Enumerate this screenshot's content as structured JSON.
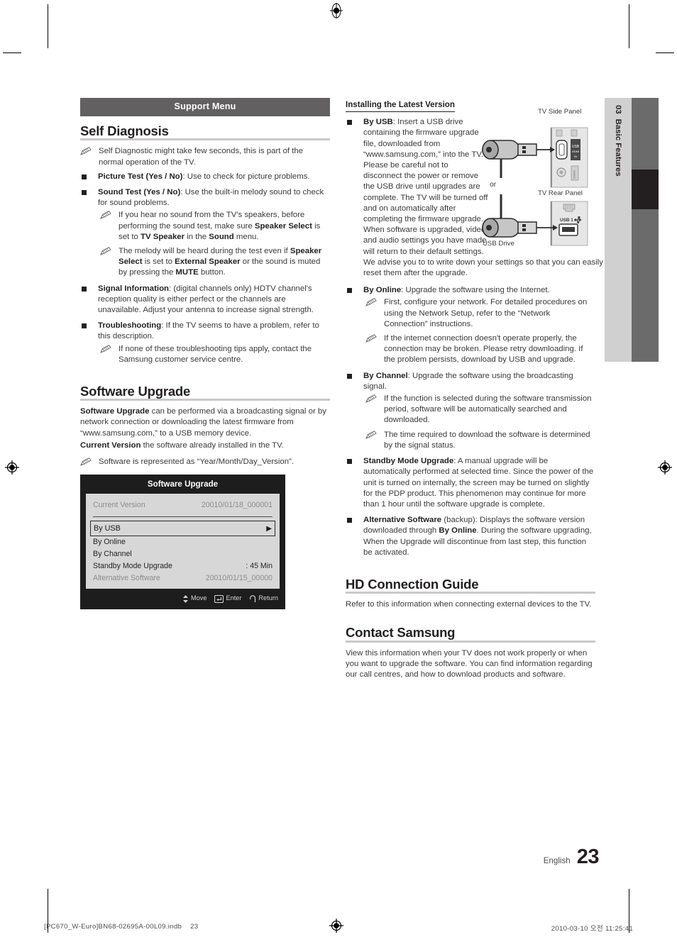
{
  "doc": {
    "chapter_number": "03",
    "chapter_title": "Basic Features",
    "language": "English",
    "page_number": "23",
    "print_filename": "[PC670_W-Euro]BN68-02695A-00L09.indb",
    "print_page": "23",
    "print_timestamp": "2010-03-10   오전 11:25:41"
  },
  "colors": {
    "band": "#636061",
    "rule": "#c9c9c9",
    "text": "#3a3a3c",
    "heading": "#231f20",
    "osd_bg": "#1d1d1d",
    "osd_panel": "#d7d7d7",
    "tab_light": "#d0d0d0",
    "tab_dark": "#6b6b6b",
    "tab_marker": "#231f20"
  },
  "support_menu_band": {
    "label": "Support Menu"
  },
  "self_diagnosis": {
    "heading": "Self Diagnosis",
    "note_intro": "Self Diagnostic might take few seconds, this is part of the normal operation of the TV.",
    "items": [
      {
        "term": "Picture Test (Yes / No)",
        "rest": ": Use to check for picture problems."
      },
      {
        "term": "Sound Test (Yes / No)",
        "rest": ": Use the built-in melody sound to check for sound problems."
      }
    ],
    "sound_notes": [
      {
        "p1": "If you hear no sound from the TV's speakers, before performing the sound test, make sure ",
        "b1": "Speaker Select",
        "p2": " is set to ",
        "b2": "TV Speaker",
        "p3": " in the ",
        "b3": "Sound",
        "p4": " menu."
      },
      {
        "p1": "The melody will be heard during the test even if ",
        "b1": "Speaker Select",
        "p2": " is set to ",
        "b2": "External Speaker",
        "p3": " or the sound is muted by pressing the ",
        "b3": "MUTE",
        "p4": " button."
      }
    ],
    "signal_information": {
      "term": "Signal Information",
      "rest": ": (digital channels only) HDTV channel's reception quality is either perfect or the channels are unavailable. Adjust your antenna to increase signal strength."
    },
    "troubleshooting": {
      "term": "Troubleshooting",
      "rest": ": If the TV seems to have a problem, refer to this description.",
      "note": "If none of these troubleshooting tips apply, contact the Samsung customer service centre."
    }
  },
  "software_upgrade": {
    "heading": "Software Upgrade",
    "intro_term": "Software Upgrade",
    "intro_rest": " can be performed via a broadcasting signal or by network connection or downloading the latest firmware from “www.samsung.com,” to a USB memory device.",
    "current_version_term": "Current Version",
    "current_version_rest": " the software already installed in the TV.",
    "note": "Software is represented as “Year/Month/Day_Version”.",
    "osd": {
      "title": "Software Upgrade",
      "current_version_label": "Current Version",
      "current_version_value": "20010/01/18_000001",
      "selected_item": "By USB",
      "selected_arrow": "▶",
      "rows": [
        {
          "label": "By Online",
          "value": ""
        },
        {
          "label": "By Channel",
          "value": ""
        },
        {
          "label": "Standby Mode Upgrade",
          "value": ": 45 Min"
        },
        {
          "label": "Alternative Software",
          "value": "20010/01/15_00000"
        }
      ],
      "footer": [
        {
          "icon": "updown-arrow-icon",
          "label": "Move"
        },
        {
          "icon": "enter-key-icon",
          "label": "Enter"
        },
        {
          "icon": "return-arrow-icon",
          "label": "Return"
        }
      ]
    }
  },
  "installing_latest_version": {
    "heading": "Installing the Latest Version",
    "by_usb": {
      "term": "By USB",
      "rest": ": Insert a USB drive containing the firmware upgrade file, downloaded from “www.samsung.com,” into the TV. Please be careful not to disconnect the power or remove the USB drive until upgrades are complete. The TV will be turned off and on automatically after completing the firmware upgrade. When software is upgraded, video and audio settings you have made will return to their default settings. We advise you to to write down your settings so that you can easily reset them after the upgrade."
    },
    "diagram": {
      "side_panel_label": "TV Side Panel",
      "rear_panel_label": "TV Rear Panel",
      "usb_drive_label": "USB Drive",
      "or_label": "or",
      "rear_port_label": "USB 1"
    },
    "by_online": {
      "term": "By Online",
      "rest": ": Upgrade the software using the Internet.",
      "notes": [
        "First, configure your network. For detailed procedures on using the Network Setup, refer to the “Network Connection” instructions.",
        "If the internet connection doesn't operate properly, the connection may be broken. Please retry downloading. If the problem persists, download by USB and upgrade."
      ]
    },
    "by_channel": {
      "term": "By Channel",
      "rest": ": Upgrade the software using the broadcasting signal.",
      "notes": [
        "If the function is selected during the software transmission period, software will be automatically searched and downloaded.",
        "The time required to download the software is determined by the signal status."
      ]
    },
    "standby_mode_upgrade": {
      "term": "Standby Mode Upgrade",
      "rest": ": A manual upgrade will be automatically performed at selected time. Since the power of the unit is turned on internally, the screen may be turned on slightly for the PDP product. This phenomenon may continue for more than 1 hour until the software upgrade is complete."
    },
    "alternative_software": {
      "term": "Alternative Software",
      "p1": " (backup): Displays the software version downloaded through ",
      "b1": "By Online",
      "p2": ". During the software upgrading, When the Upgrade will discontinue from last step, this function be activated."
    }
  },
  "hd_connection_guide": {
    "heading": "HD Connection Guide",
    "body": "Refer to this information when connecting external devices to the TV."
  },
  "contact_samsung": {
    "heading": "Contact Samsung",
    "body": "View this information when your TV does not work properly or when you want to upgrade the software. You can find information regarding our call centres, and how to download products and software."
  }
}
